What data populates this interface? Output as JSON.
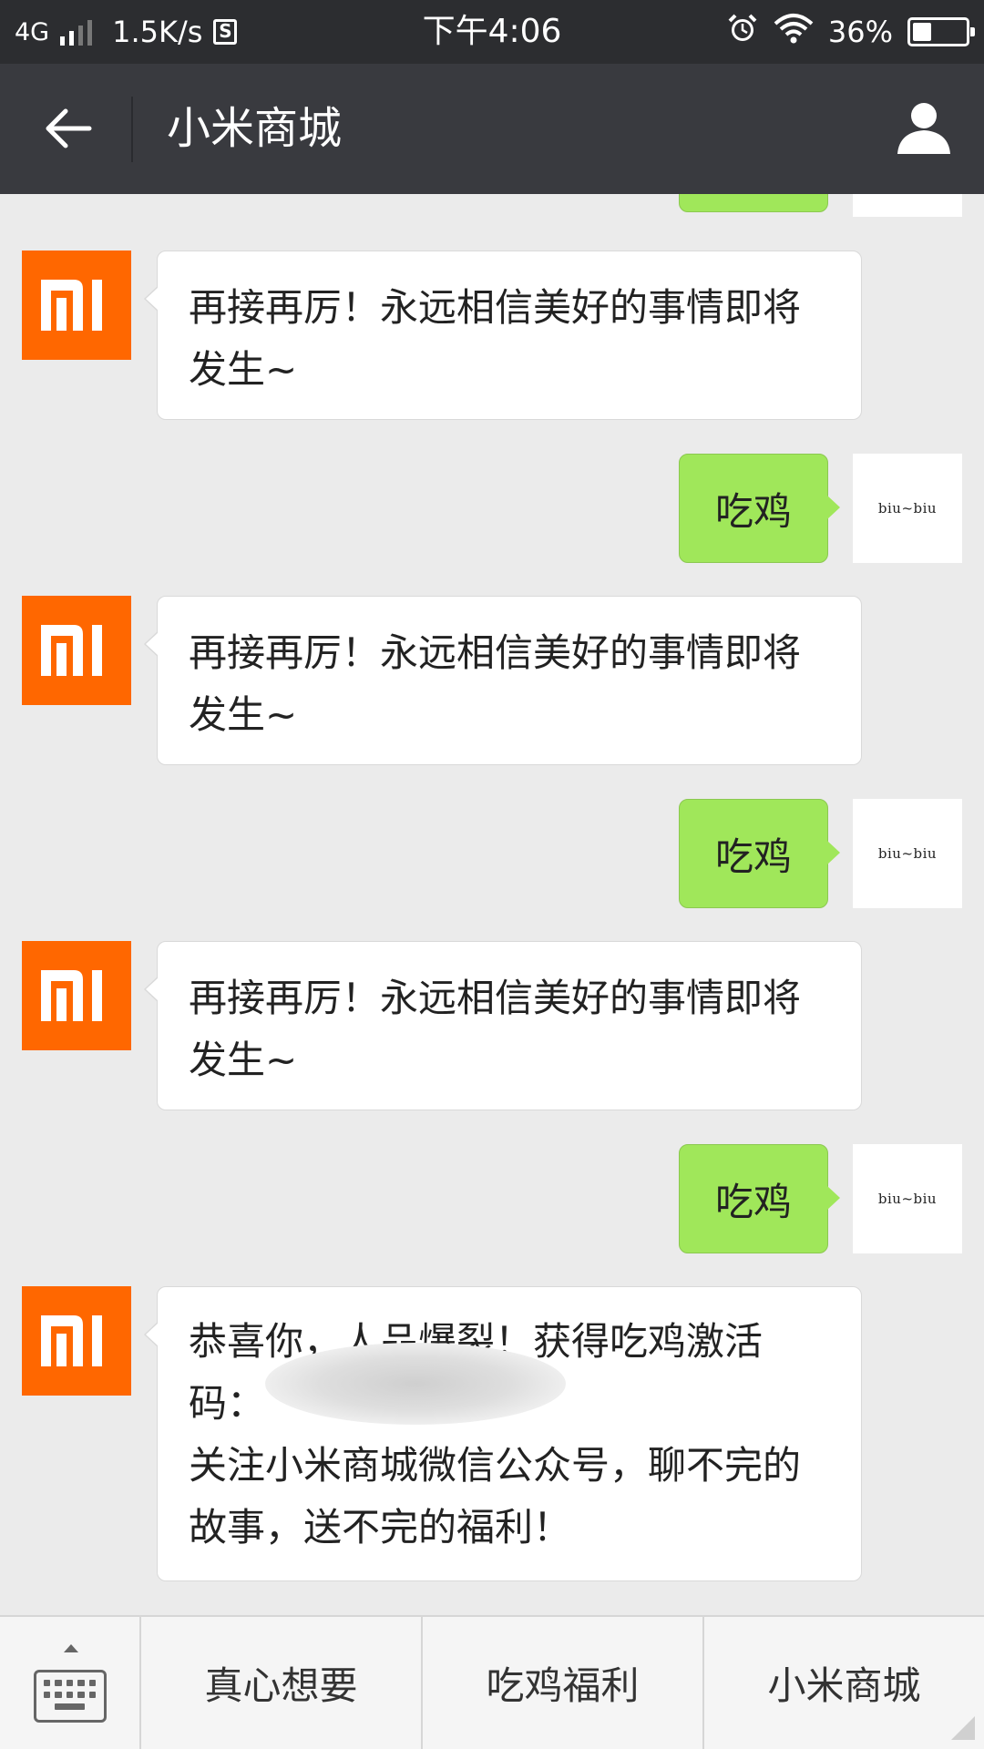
{
  "status_bar": {
    "network": "4G",
    "speed": "1.5K/s",
    "s_icon": "S",
    "time": "下午4:06",
    "battery": "36%",
    "battery_level": 0.36,
    "icons": [
      "signal-icon",
      "alarm-icon",
      "wifi-icon",
      "battery-icon"
    ]
  },
  "header": {
    "title": "小米商城",
    "back_icon": "back-arrow-icon",
    "profile_icon": "user-icon"
  },
  "avatars": {
    "mi_logo": "MI",
    "me_label": "biu~biu"
  },
  "messages": [
    {
      "from": "them",
      "text": "再接再厉！永远相信美好的事情即将发生~"
    },
    {
      "from": "me",
      "text": "吃鸡"
    },
    {
      "from": "them",
      "text": "再接再厉！永远相信美好的事情即将发生~"
    },
    {
      "from": "me",
      "text": "吃鸡"
    },
    {
      "from": "them",
      "text": "再接再厉！永远相信美好的事情即将发生~"
    },
    {
      "from": "me",
      "text": "吃鸡"
    },
    {
      "from": "them",
      "text_line1": "恭喜你，人品爆裂！获得吃鸡激活",
      "text_code_label": "码：",
      "text_line3": "关注小米商城微信公众号，聊不完的故事，送不完的福利！"
    }
  ],
  "bottom_menu": {
    "keyboard_icon": "keyboard-icon",
    "items": [
      "真心想要",
      "吃鸡福利",
      "小米商城"
    ]
  },
  "colors": {
    "status_bg": "#2c2d30",
    "header_bg": "#393a3f",
    "chat_bg": "#ebebeb",
    "mi_orange": "#ff6700",
    "out_bubble": "#a0e75a"
  }
}
